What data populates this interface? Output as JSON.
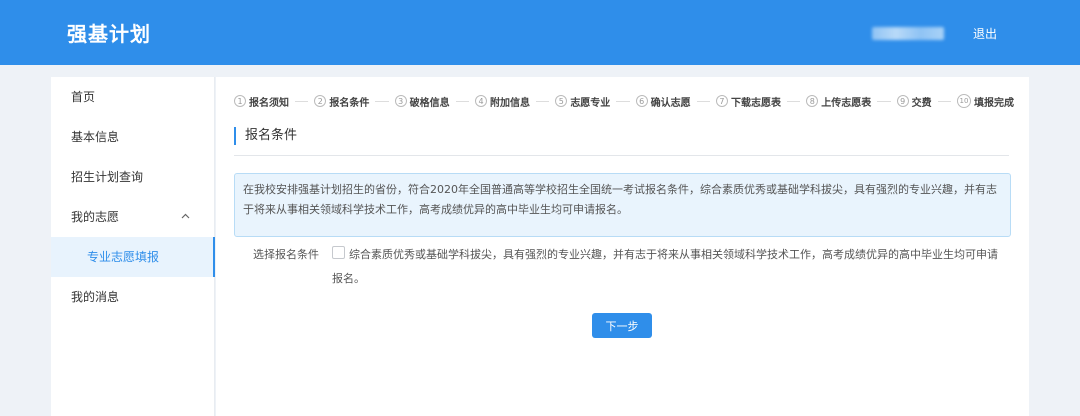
{
  "header": {
    "title": "强基计划",
    "logout_label": "退出"
  },
  "sidebar": {
    "items": [
      {
        "label": "首页"
      },
      {
        "label": "基本信息"
      },
      {
        "label": "招生计划查询"
      },
      {
        "label": "我的志愿",
        "expanded": true,
        "icon": "chevron-up-icon"
      },
      {
        "label": "专业志愿填报",
        "active": true
      },
      {
        "label": "我的消息"
      }
    ]
  },
  "steps": [
    {
      "num": "1",
      "label": "报名须知"
    },
    {
      "num": "2",
      "label": "报名条件"
    },
    {
      "num": "3",
      "label": "破格信息"
    },
    {
      "num": "4",
      "label": "附加信息"
    },
    {
      "num": "5",
      "label": "志愿专业"
    },
    {
      "num": "6",
      "label": "确认志愿"
    },
    {
      "num": "7",
      "label": "下载志愿表"
    },
    {
      "num": "8",
      "label": "上传志愿表"
    },
    {
      "num": "9",
      "label": "交费"
    },
    {
      "num": "10",
      "label": "填报完成"
    }
  ],
  "section": {
    "title": "报名条件"
  },
  "notice": {
    "text": "在我校安排强基计划招生的省份，符合2020年全国普通高等学校招生全国统一考试报名条件，综合素质优秀或基础学科拔尖，具有强烈的专业兴趣，并有志于将来从事相关领域科学技术工作，高考成绩优异的高中毕业生均可申请报名。"
  },
  "form": {
    "label": "选择报名条件",
    "option_text": "综合素质优秀或基础学科拔尖，具有强烈的专业兴趣，并有志于将来从事相关领域科学技术工作，高考成绩优异的高中毕业生均可申请报名。",
    "checked": false
  },
  "actions": {
    "next_label": "下一步"
  },
  "colors": {
    "primary": "#2f8eea",
    "notice_bg": "#e9f4fd",
    "notice_border": "#b8dcf6",
    "page_bg": "#eef2f7"
  }
}
